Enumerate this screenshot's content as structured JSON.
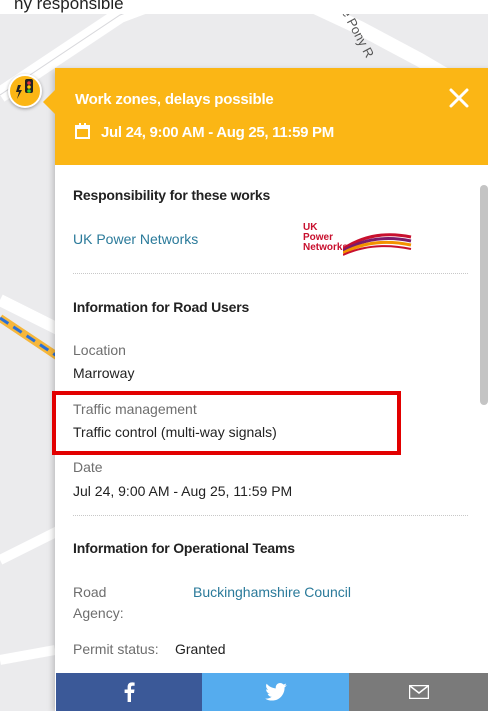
{
  "caption": {
    "text": "(cropped caption text above screenshot)"
  },
  "map": {
    "road_label": "e Pony R"
  },
  "popup": {
    "title": "Work zones, delays possible",
    "date_range": "Jul 24, 9:00 AM - Aug 25, 11:59 PM",
    "close_icon": "close-icon",
    "calendar_icon": "calendar-icon",
    "responsibility": {
      "heading": "Responsibility for these works",
      "company": "UK Power Networks",
      "logo_lines": [
        "UK",
        "Power",
        "Networks"
      ]
    },
    "road_users": {
      "heading": "Information for Road Users",
      "location_label": "Location",
      "location_value": "Marroway",
      "traffic_label": "Traffic management",
      "traffic_value": "Traffic control (multi-way signals)",
      "date_label": "Date",
      "date_value": "Jul 24, 9:00 AM - Aug 25, 11:59 PM"
    },
    "operational": {
      "heading": "Information for Operational Teams",
      "agency_label_1": "Road",
      "agency_label_2": "Agency:",
      "agency_value": "Buckinghamshire Council",
      "permit_label": "Permit status:",
      "permit_value": "Granted"
    }
  },
  "share": {
    "facebook_icon": "facebook-icon",
    "twitter_icon": "twitter-icon",
    "mail_icon": "mail-icon"
  },
  "colors": {
    "header": "#fbb615",
    "link": "#2a7a9a",
    "highlight": "#e20000",
    "facebook": "#3b5998",
    "twitter": "#55acee",
    "mail": "#7a7a7a"
  }
}
